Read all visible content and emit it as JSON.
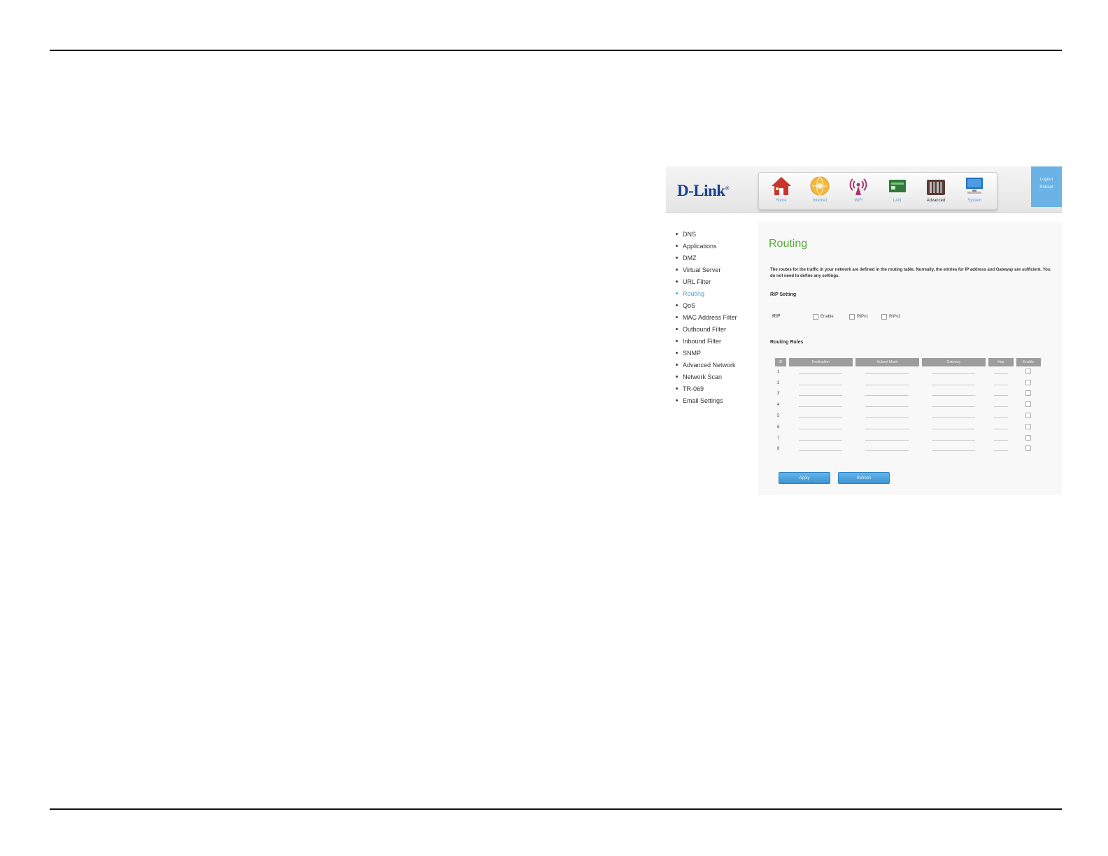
{
  "brand": {
    "logo": "D-Link"
  },
  "nav": [
    {
      "label": "Home",
      "icon": "house-icon"
    },
    {
      "label": "Internet",
      "icon": "globe-icon"
    },
    {
      "label": "WiFi",
      "icon": "wireless-icon"
    },
    {
      "label": "LAN",
      "icon": "lan-icon"
    },
    {
      "label": "Advanced",
      "icon": "toolbox-icon"
    },
    {
      "label": "System",
      "icon": "monitor-icon"
    }
  ],
  "logout": {
    "line1": "Logout",
    "line2": "Reboot"
  },
  "sidebar": [
    "DNS",
    "Applications",
    "DMZ",
    "Virtual Server",
    "URL Filter",
    "Routing",
    "QoS",
    "MAC Address Filter",
    "Outbound Filter",
    "Inbound Filter",
    "SNMP",
    "Advanced Network",
    "Network Scan",
    "TR-069",
    "Email Settings"
  ],
  "page": {
    "title": "Routing",
    "description": "The routes for the traffic in your network are defined in the routing table. Normally, the entries for IP address and Gateway are sufficient. You do not need to define any settings.",
    "rip_section": "RIP Setting",
    "rip_label": "RIP",
    "rip_options": [
      "Enable",
      "RIPv1",
      "RIPv2"
    ],
    "rules_section": "Routing Rules",
    "columns": [
      "ID",
      "Destination",
      "Subnet Mask",
      "Gateway",
      "Hop",
      "Enable"
    ],
    "rows": [
      "1",
      "2",
      "3",
      "4",
      "5",
      "6",
      "7",
      "8"
    ],
    "buttons": {
      "apply": "Apply",
      "refresh": "Refresh"
    }
  }
}
